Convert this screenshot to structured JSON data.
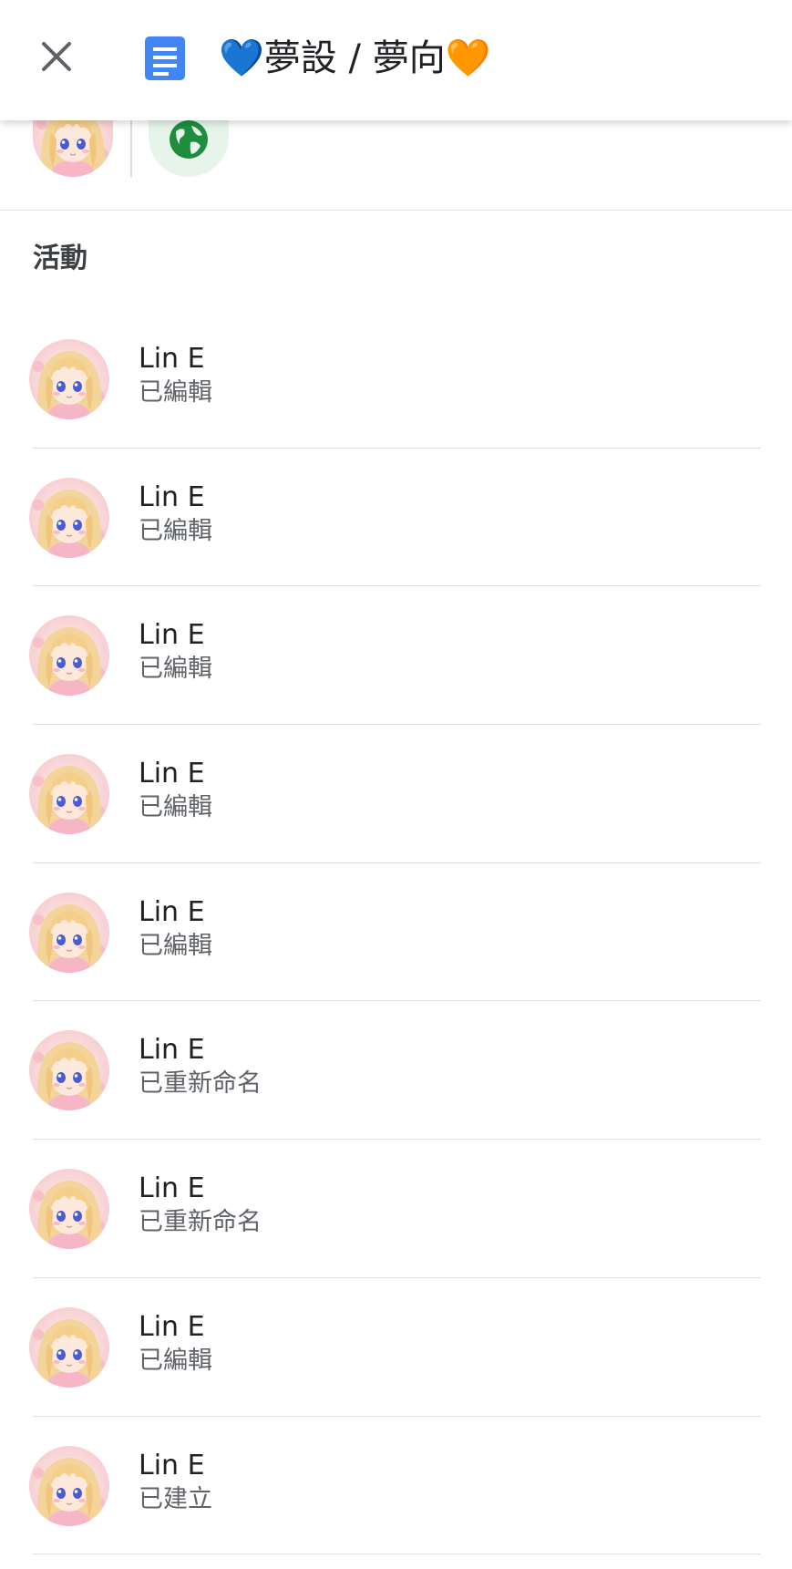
{
  "header": {
    "title": "💙夢設 / 夢向🧡",
    "close_icon": "close-icon",
    "doc_icon": "google-docs-icon",
    "doc_color": "#4285f4"
  },
  "sharing": {
    "visibility_icon": "globe-icon",
    "visibility_color": "#1e8e3e",
    "chip_bg": "#e6f4ea"
  },
  "activity": {
    "heading": "活動",
    "items": [
      {
        "name": "Lin E",
        "action": "已編輯"
      },
      {
        "name": "Lin E",
        "action": "已編輯"
      },
      {
        "name": "Lin E",
        "action": "已編輯"
      },
      {
        "name": "Lin E",
        "action": "已編輯"
      },
      {
        "name": "Lin E",
        "action": "已編輯"
      },
      {
        "name": "Lin E",
        "action": "已重新命名"
      },
      {
        "name": "Lin E",
        "action": "已重新命名"
      },
      {
        "name": "Lin E",
        "action": "已編輯"
      },
      {
        "name": "Lin E",
        "action": "已建立"
      }
    ]
  }
}
